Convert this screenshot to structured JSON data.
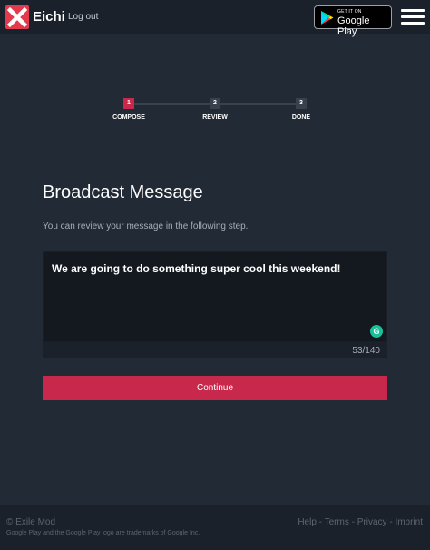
{
  "header": {
    "brand": "Eichi",
    "logout_label": "Log out",
    "store_badge": {
      "small_text": "GET IT ON",
      "big_text": "Google Play"
    }
  },
  "stepper": {
    "steps": [
      {
        "number": "1",
        "label": "COMPOSE",
        "active": true
      },
      {
        "number": "2",
        "label": "REVIEW",
        "active": false
      },
      {
        "number": "3",
        "label": "DONE",
        "active": false
      }
    ]
  },
  "main": {
    "title": "Broadcast Message",
    "subtitle": "You can review your message in the following step.",
    "message": "We are going to do something super cool this weekend!",
    "grammarly_glyph": "G",
    "char_count": "53/140",
    "continue_label": "Continue"
  },
  "footer": {
    "copyright": "© Exile Mod",
    "trademark": "Google Play and the Google Play logo are trademarks of Google Inc.",
    "links": [
      "Help",
      "Terms",
      "Privacy",
      "Imprint"
    ],
    "separator": " - "
  },
  "colors": {
    "background": "#222a36",
    "header": "#1b212b",
    "accent": "#c7284c",
    "logo": "#e23b4e",
    "grammarly": "#15c39a"
  },
  "icons": {
    "logo": "x-logo-icon",
    "store": "google-play-icon",
    "menu": "hamburger-menu-icon",
    "grammarly": "grammarly-icon"
  }
}
